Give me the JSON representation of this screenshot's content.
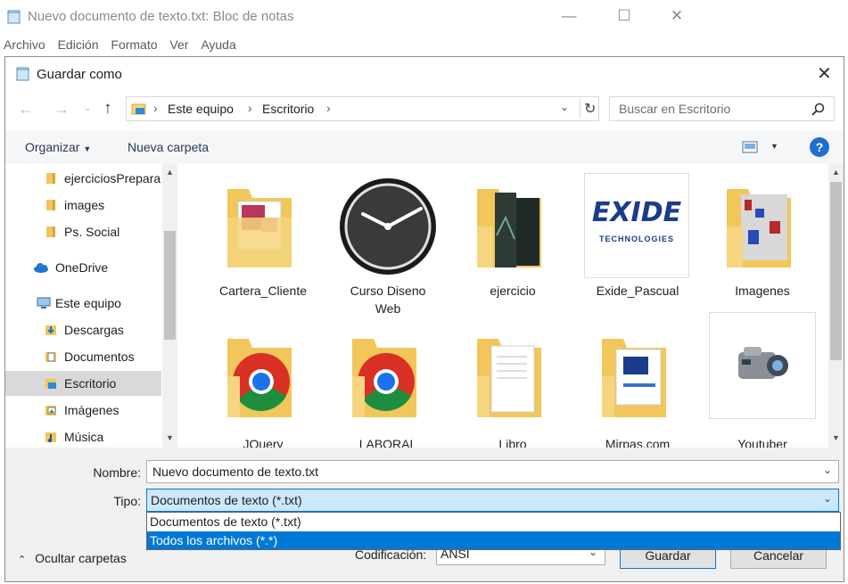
{
  "notepad": {
    "title": "Nuevo documento de texto.txt: Bloc de notas",
    "menu": [
      "Archivo",
      "Edición",
      "Formato",
      "Ver",
      "Ayuda"
    ]
  },
  "dialog": {
    "title": "Guardar como",
    "breadcrumb": [
      "Este equipo",
      "Escritorio"
    ],
    "search_placeholder": "Buscar en Escritorio",
    "toolbar": {
      "organize": "Organizar",
      "new_folder": "Nueva carpeta"
    },
    "sidebar": [
      {
        "label": "ejerciciosPrepara",
        "icon": "folder-icon"
      },
      {
        "label": "images",
        "icon": "folder-icon"
      },
      {
        "label": "Ps. Social",
        "icon": "folder-icon"
      },
      {
        "label": "OneDrive",
        "icon": "cloud-icon"
      },
      {
        "label": "Este equipo",
        "icon": "computer-icon"
      },
      {
        "label": "Descargas",
        "icon": "download-folder-icon"
      },
      {
        "label": "Documentos",
        "icon": "documents-folder-icon"
      },
      {
        "label": "Escritorio",
        "icon": "desktop-folder-icon",
        "selected": true
      },
      {
        "label": "Imágenes",
        "icon": "pictures-folder-icon"
      },
      {
        "label": "Música",
        "icon": "music-folder-icon"
      }
    ],
    "files": [
      {
        "name": "Cartera_Cliente",
        "icon": "access-folder-icon"
      },
      {
        "name": "Curso Diseno Web",
        "icon": "clock-icon"
      },
      {
        "name": "ejercicio",
        "icon": "image-folder-icon"
      },
      {
        "name": "Exide_Pascual",
        "icon": "exide-logo-icon"
      },
      {
        "name": "Imagenes",
        "icon": "image-folder-icon"
      },
      {
        "name": "JQuery",
        "icon": "chrome-folder-icon"
      },
      {
        "name": "LABORAL",
        "icon": "chrome-folder-icon"
      },
      {
        "name": "Libro",
        "icon": "document-folder-icon"
      },
      {
        "name": "Mirpas.com",
        "icon": "web-folder-icon"
      },
      {
        "name": "Youtuber",
        "icon": "camera-icon"
      }
    ],
    "exide_logo": {
      "line1": "EXIDE",
      "line2": "TECHNOLOGIES"
    },
    "filename_label": "Nombre:",
    "filename_value": "Nuevo documento de texto.txt",
    "type_label": "Tipo:",
    "type_value": "Documentos de texto (*.txt)",
    "type_options": [
      "Documentos de texto (*.txt)",
      "Todos los archivos  (*.*)"
    ],
    "hide_folders": "Ocultar carpetas",
    "encoding_label": "Codificación:",
    "encoding_value": "ANSI",
    "save": "Guardar",
    "cancel": "Cancelar",
    "colors": {
      "selection": "#0078d7",
      "selected_item": "#cce8ff",
      "help": "#1c6fd1"
    }
  }
}
